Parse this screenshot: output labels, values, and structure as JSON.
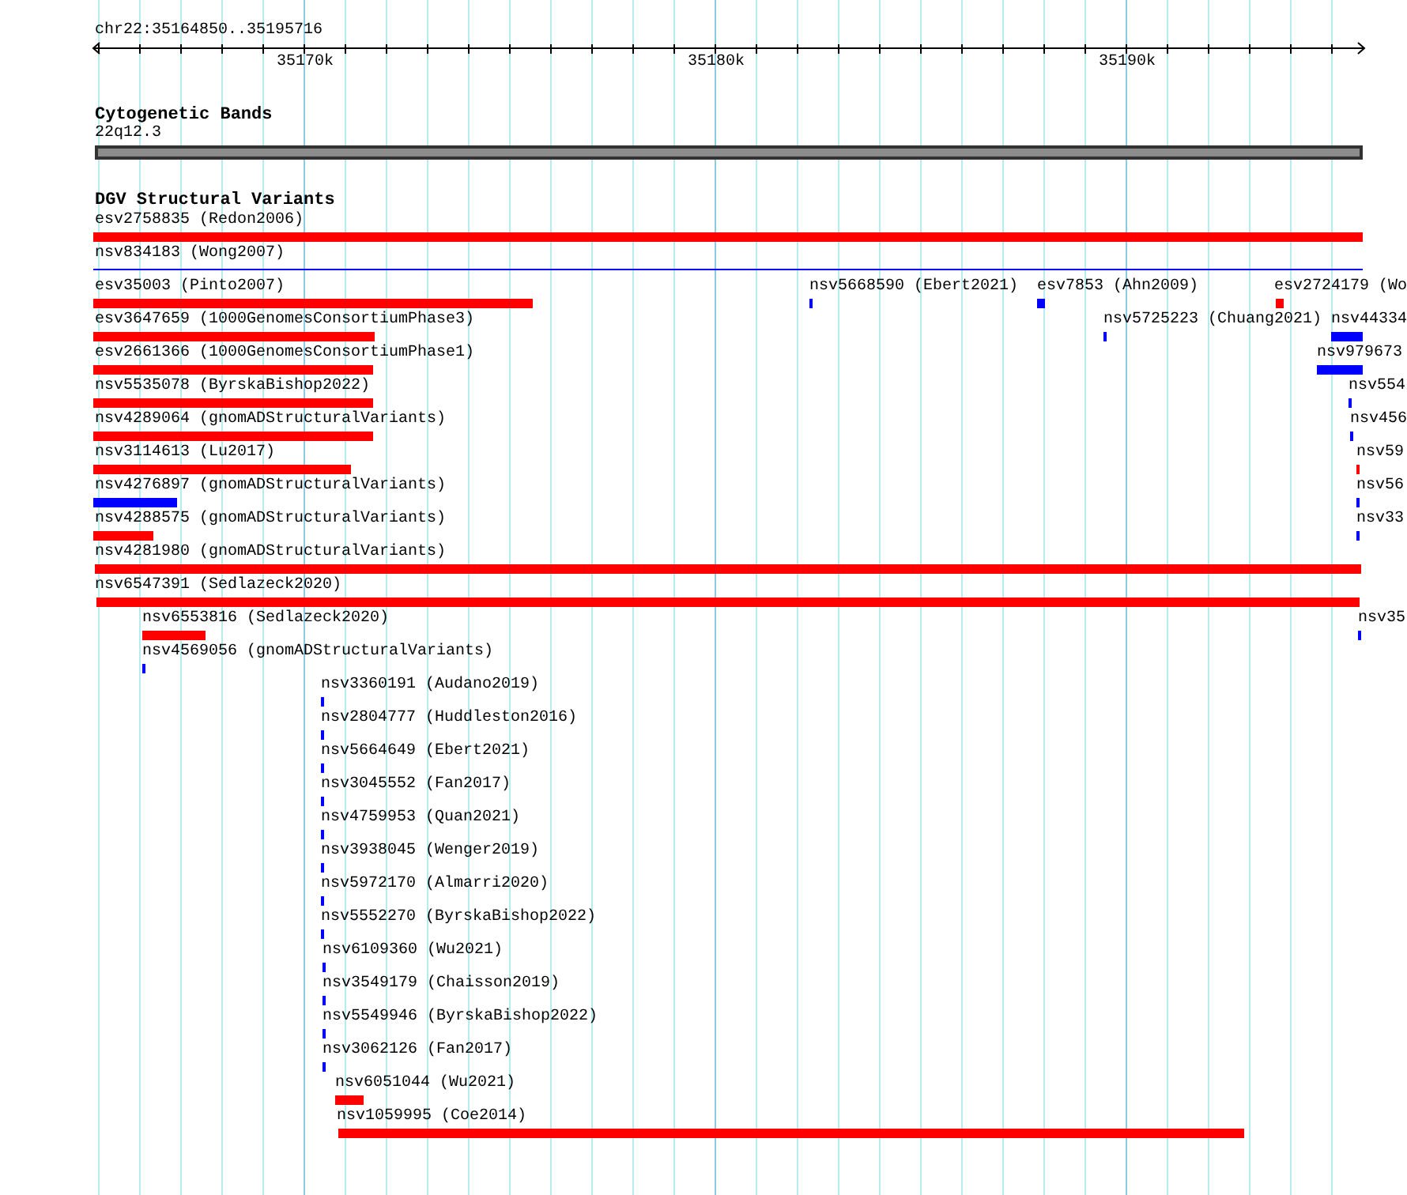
{
  "ruler": {
    "location": "chr22:35164850..35195716",
    "tick_labels": [
      "35170k",
      "35180k",
      "35190k"
    ]
  },
  "cytogenetic_track": {
    "title": "Cytogenetic Bands",
    "band": "22q12.3"
  },
  "variants_track": {
    "title": "DGV Structural Variants",
    "features": [
      {
        "label": "esv2758835 (Redon2006)",
        "color": "#ff0000"
      },
      {
        "label": "nsv834183 (Wong2007)",
        "color": "#0000ff"
      },
      {
        "label": "esv35003 (Pinto2007)",
        "color": "#ff0000"
      },
      {
        "label": "nsv5668590 (Ebert2021)",
        "color": "#0000ff"
      },
      {
        "label": "esv7853 (Ahn2009)",
        "color": "#0000ff"
      },
      {
        "label": "esv2724179 (Wo",
        "color": "#ff0000"
      },
      {
        "label": "esv3647659 (1000GenomesConsortiumPhase3)",
        "color": "#ff0000"
      },
      {
        "label": "nsv5725223 (Chuang2021)",
        "color": "#0000ff"
      },
      {
        "label": "nsv44334",
        "color": "#0000ff"
      },
      {
        "label": "esv2661366 (1000GenomesConsortiumPhase1)",
        "color": "#ff0000"
      },
      {
        "label": "nsv979673",
        "color": "#0000ff"
      },
      {
        "label": "nsv5535078 (ByrskaBishop2022)",
        "color": "#ff0000"
      },
      {
        "label": "nsv554",
        "color": "#0000ff"
      },
      {
        "label": "nsv4289064 (gnomADStructuralVariants)",
        "color": "#ff0000"
      },
      {
        "label": "nsv456",
        "color": "#0000ff"
      },
      {
        "label": "nsv3114613 (Lu2017)",
        "color": "#ff0000"
      },
      {
        "label": "nsv59",
        "color": "#ff0000"
      },
      {
        "label": "nsv4276897 (gnomADStructuralVariants)",
        "color": "#0000ff"
      },
      {
        "label": "nsv56",
        "color": "#0000ff"
      },
      {
        "label": "nsv4288575 (gnomADStructuralVariants)",
        "color": "#ff0000"
      },
      {
        "label": "nsv33",
        "color": "#0000ff"
      },
      {
        "label": "nsv4281980 (gnomADStructuralVariants)",
        "color": "#ff0000"
      },
      {
        "label": "nsv6547391 (Sedlazeck2020)",
        "color": "#ff0000"
      },
      {
        "label": "nsv6553816 (Sedlazeck2020)",
        "color": "#ff0000"
      },
      {
        "label": "nsv35",
        "color": "#0000ff"
      },
      {
        "label": "nsv4569056 (gnomADStructuralVariants)",
        "color": "#0000ff"
      },
      {
        "label": "nsv3360191 (Audano2019)",
        "color": "#0000ff"
      },
      {
        "label": "nsv2804777 (Huddleston2016)",
        "color": "#0000ff"
      },
      {
        "label": "nsv5664649 (Ebert2021)",
        "color": "#0000ff"
      },
      {
        "label": "nsv3045552 (Fan2017)",
        "color": "#0000ff"
      },
      {
        "label": "nsv4759953 (Quan2021)",
        "color": "#0000ff"
      },
      {
        "label": "nsv3938045 (Wenger2019)",
        "color": "#0000ff"
      },
      {
        "label": "nsv5972170 (Almarri2020)",
        "color": "#0000ff"
      },
      {
        "label": "nsv5552270 (ByrskaBishop2022)",
        "color": "#0000ff"
      },
      {
        "label": "nsv6109360 (Wu2021)",
        "color": "#0000ff"
      },
      {
        "label": "nsv3549179 (Chaisson2019)",
        "color": "#0000ff"
      },
      {
        "label": "nsv5549946 (ByrskaBishop2022)",
        "color": "#0000ff"
      },
      {
        "label": "nsv3062126 (Fan2017)",
        "color": "#0000ff"
      },
      {
        "label": "nsv6051044 (Wu2021)",
        "color": "#ff0000"
      },
      {
        "label": "nsv1059995 (Coe2014)",
        "color": "#ff0000"
      }
    ]
  }
}
